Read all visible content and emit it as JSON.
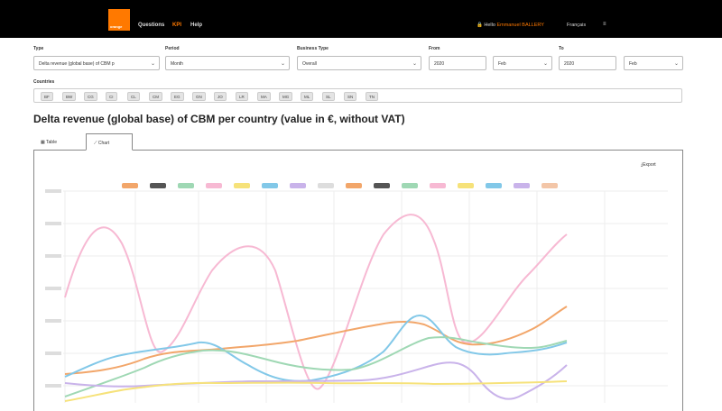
{
  "header": {
    "logo_text": "orange",
    "nav": [
      "Questions",
      "KPI",
      "Help"
    ],
    "user_prefix": "Hello",
    "user_name": "Emmanuel BALLERY",
    "language": "Français"
  },
  "filters": {
    "type_label": "Type",
    "type_value": "Delta revenue (global base) of CBM p",
    "period_label": "Period",
    "period_value": "Month",
    "business_label": "Business Type",
    "business_value": "Overall",
    "from_label": "From",
    "from_year": "2020",
    "from_month": "Feb",
    "to_label": "To",
    "to_year": "2020",
    "to_month": "Feb"
  },
  "countries": {
    "label": "Countries",
    "chips": [
      "BF",
      "BW",
      "CG",
      "CI",
      "CL",
      "CM",
      "EG",
      "GN",
      "JO",
      "LR",
      "MA",
      "MG",
      "ML",
      "SL",
      "SN",
      "TN"
    ]
  },
  "page": {
    "title": "Delta revenue (global base) of CBM per country (value in €, without VAT)",
    "tab_table": "Table",
    "tab_chart": "Chart",
    "export": "Export"
  },
  "colors": {
    "accent": "#ff7900",
    "series": [
      "#f2a66a",
      "#555555",
      "#9fd8b4",
      "#f7b9d3",
      "#f6e27a",
      "#82c8e8",
      "#c9b3ea",
      "#dddddd",
      "#f2a66a",
      "#555555",
      "#9fd8b4",
      "#f7b9d3",
      "#f6e27a",
      "#82c8e8",
      "#c9b3ea",
      "#f3c6a8"
    ]
  }
}
